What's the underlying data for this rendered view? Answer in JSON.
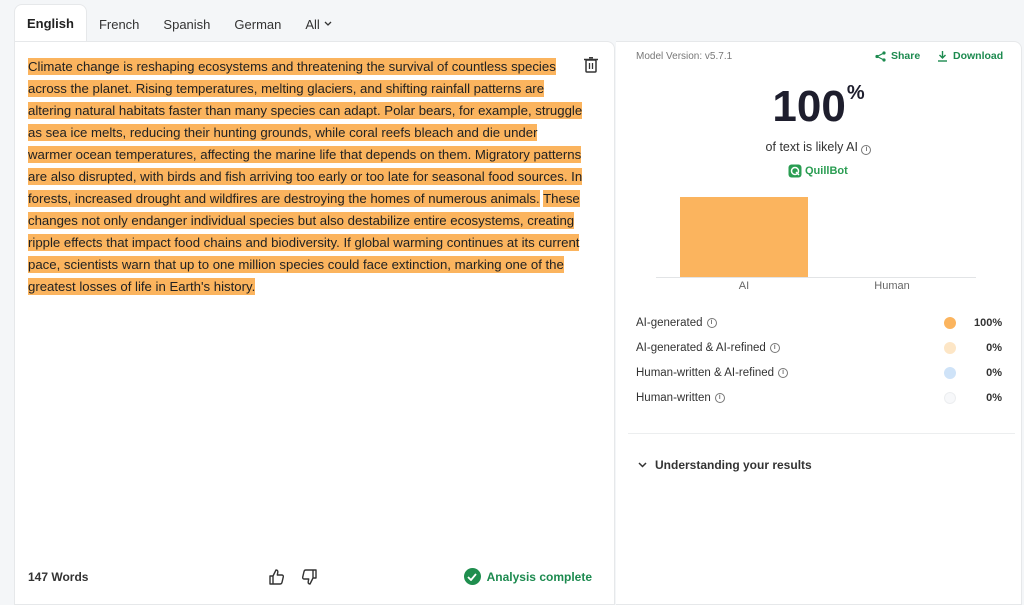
{
  "tabs": [
    {
      "label": "English"
    },
    {
      "label": "French"
    },
    {
      "label": "Spanish"
    },
    {
      "label": "German"
    },
    {
      "label": "All"
    }
  ],
  "editor": {
    "segments": [
      "Climate change is reshaping ecosystems and threatening the survival of countless species across the planet. Rising temperatures, melting glaciers, and shifting rainfall patterns are altering natural habitats faster than many species can adapt. Polar bears, for example, struggle as sea ice melts, reducing their hunting grounds, while coral reefs bleach and die under warmer ocean temperatures, affecting the marine life that depends on them. Migratory patterns are also disrupted, with birds and fish arriving too early or too late for seasonal food sources. In forests, increased drought and wildfires are destroying the homes of numerous animals.",
      "These changes not only endanger individual species but also destabilize entire ecosystems, creating ripple effects that impact food chains and biodiversity. If global warming continues at its current pace, scientists warn that up to one million species could face extinction, marking one of the greatest losses of life in Earth's history."
    ],
    "word_count": "147 Words",
    "status": "Analysis complete"
  },
  "results": {
    "model_version": "Model Version: v5.7.1",
    "share_label": "Share",
    "download_label": "Download",
    "score": "100",
    "score_unit": "%",
    "score_sub": "of text is likely AI",
    "brand": "QuillBot",
    "understanding": "Understanding your results",
    "legend": [
      {
        "label": "AI-generated",
        "pct": "100%",
        "color": "#fbb45e"
      },
      {
        "label": "AI-generated & AI-refined",
        "pct": "0%",
        "color": "#fde6c6"
      },
      {
        "label": "Human-written & AI-refined",
        "pct": "0%",
        "color": "#cfe3f8"
      },
      {
        "label": "Human-written",
        "pct": "0%",
        "color": "#f7f8fa"
      }
    ]
  },
  "chart_data": {
    "type": "bar",
    "categories": [
      "AI",
      "Human"
    ],
    "values": [
      100,
      0
    ],
    "ylim": [
      0,
      100
    ],
    "color": "#fbb45e"
  }
}
